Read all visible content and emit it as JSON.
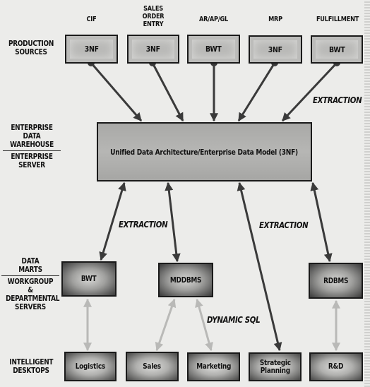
{
  "tiers": {
    "production": {
      "lines": [
        "PRODUCTION",
        "SOURCES"
      ]
    },
    "warehouse": {
      "top": [
        "ENTERPRISE",
        "DATA",
        "WAREHOUSE"
      ],
      "bottom": [
        "ENTERPRISE",
        "SERVER"
      ]
    },
    "marts": {
      "top": [
        "DATA",
        "MARTS"
      ],
      "bottom": [
        "WORKGROUP &",
        "DEPARTMENTAL",
        "SERVERS"
      ]
    },
    "desktops": {
      "lines": [
        "INTELLIGENT",
        "DESKTOPS"
      ]
    }
  },
  "sources": [
    {
      "title": "CIF",
      "format": "3NF"
    },
    {
      "title": "SALES ORDER ENTRY",
      "title_lines": [
        "SALES",
        "ORDER",
        "ENTRY"
      ],
      "format": "3NF"
    },
    {
      "title": "AR/AP/GL",
      "format": "BWT"
    },
    {
      "title": "MRP",
      "format": "3NF"
    },
    {
      "title": "FULFILLMENT",
      "format": "BWT"
    }
  ],
  "warehouse_box": {
    "label": "Unified Data Architecture/Enterprise Data Model (3NF)"
  },
  "marts": [
    {
      "label": "BWT"
    },
    {
      "label": "MDDBMS"
    },
    {
      "label": "RDBMS"
    }
  ],
  "desktops": [
    {
      "label": "Logistics"
    },
    {
      "label": "Sales"
    },
    {
      "label": "Marketing"
    },
    {
      "label": "Strategic Planning",
      "lines": [
        "Strategic",
        "Planning"
      ]
    },
    {
      "label": "R&D"
    }
  ],
  "annotations": {
    "extraction_top": "EXTRACTION",
    "extraction_left": "EXTRACTION",
    "extraction_right": "EXTRACTION",
    "dynamic_sql": "DYNAMIC SQL"
  },
  "connections": [
    {
      "from": "CIF",
      "to": "Unified Data Architecture",
      "type": "extraction"
    },
    {
      "from": "SALES ORDER ENTRY",
      "to": "Unified Data Architecture",
      "type": "extraction"
    },
    {
      "from": "AR/AP/GL",
      "to": "Unified Data Architecture",
      "type": "extraction"
    },
    {
      "from": "MRP",
      "to": "Unified Data Architecture",
      "type": "extraction"
    },
    {
      "from": "FULFILLMENT",
      "to": "Unified Data Architecture",
      "type": "extraction"
    },
    {
      "from": "Unified Data Architecture",
      "to": "BWT",
      "type": "extraction",
      "bidirectional": true
    },
    {
      "from": "Unified Data Architecture",
      "to": "MDDBMS",
      "type": "extraction",
      "bidirectional": true
    },
    {
      "from": "Unified Data Architecture",
      "to": "Strategic Planning",
      "type": "dynamic-sql",
      "bidirectional": true
    },
    {
      "from": "Unified Data Architecture",
      "to": "RDBMS",
      "type": "extraction",
      "bidirectional": true
    },
    {
      "from": "BWT",
      "to": "Logistics",
      "type": "local",
      "bidirectional": true
    },
    {
      "from": "MDDBMS",
      "to": "Sales",
      "type": "local",
      "bidirectional": true
    },
    {
      "from": "MDDBMS",
      "to": "Marketing",
      "type": "local",
      "bidirectional": true
    },
    {
      "from": "RDBMS",
      "to": "R&D",
      "type": "local",
      "bidirectional": true
    }
  ],
  "colors": {
    "background": "#ececea",
    "arrow_dark": "#3a3a3a",
    "arrow_light": "#b9b9b7",
    "box_border": "#1a1a1a"
  }
}
